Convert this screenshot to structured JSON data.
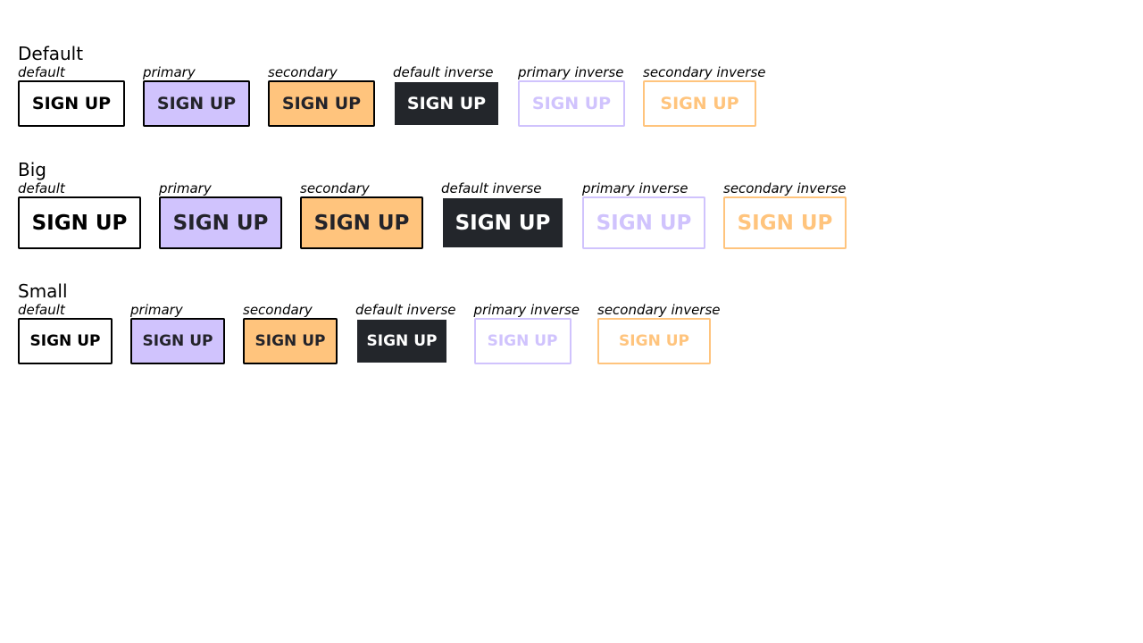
{
  "sections": {
    "default": {
      "title": "Default",
      "variants": [
        {
          "label": "default",
          "button": "SIGN UP"
        },
        {
          "label": "primary",
          "button": "SIGN UP"
        },
        {
          "label": "secondary",
          "button": "SIGN UP"
        },
        {
          "label": "default inverse",
          "button": "SIGN UP"
        },
        {
          "label": "primary inverse",
          "button": "SIGN UP"
        },
        {
          "label": "secondary inverse",
          "button": "SIGN UP"
        }
      ]
    },
    "big": {
      "title": "Big",
      "variants": [
        {
          "label": "default",
          "button": "SIGN UP"
        },
        {
          "label": "primary",
          "button": "SIGN UP"
        },
        {
          "label": "secondary",
          "button": "SIGN UP"
        },
        {
          "label": "default inverse",
          "button": "SIGN UP"
        },
        {
          "label": "primary inverse",
          "button": "SIGN UP"
        },
        {
          "label": "secondary inverse",
          "button": "SIGN UP"
        }
      ]
    },
    "small": {
      "title": "Small",
      "variants": [
        {
          "label": "default",
          "button": "SIGN UP"
        },
        {
          "label": "primary",
          "button": "SIGN UP"
        },
        {
          "label": "secondary",
          "button": "SIGN UP"
        },
        {
          "label": "default inverse",
          "button": "SIGN UP"
        },
        {
          "label": "primary inverse",
          "button": "SIGN UP"
        },
        {
          "label": "secondary inverse",
          "button": "SIGN UP"
        }
      ]
    }
  },
  "colors": {
    "black": "#000000",
    "primary": "#d0c3fd",
    "secondary": "#ffc47d",
    "inverse_dark": "#23262b"
  }
}
